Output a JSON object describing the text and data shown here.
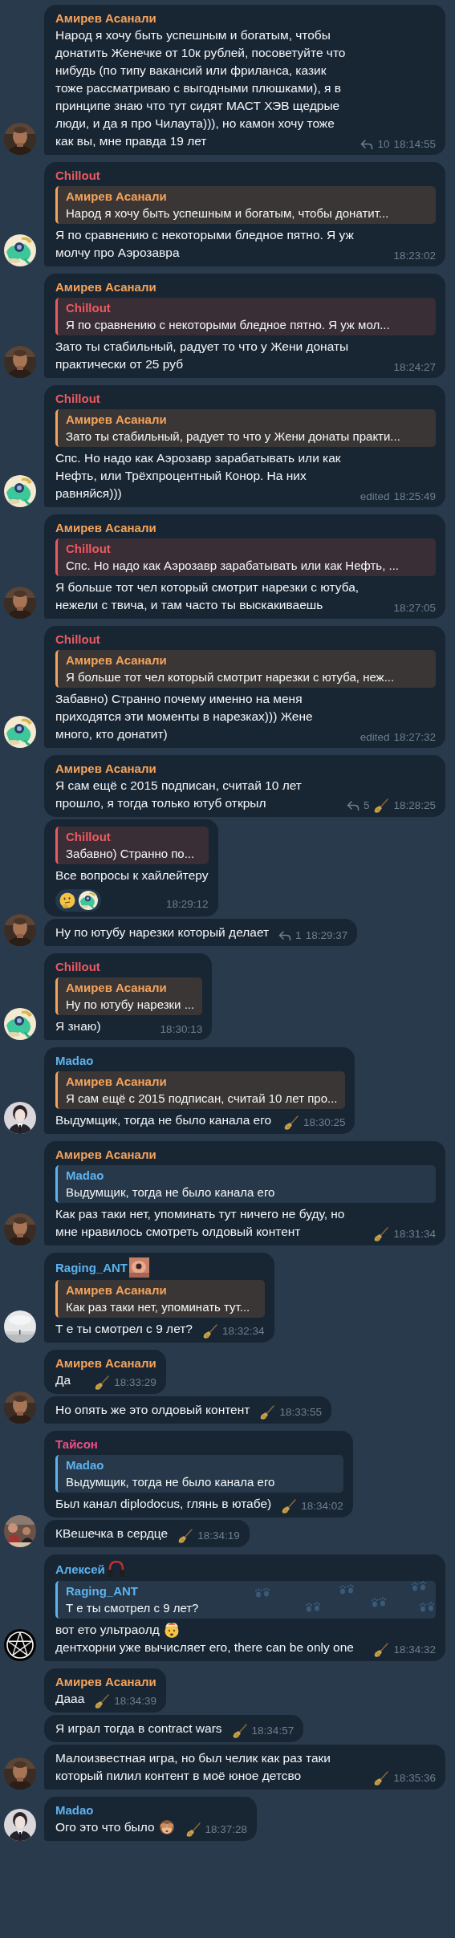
{
  "chat": {
    "groups": [
      {
        "avatar": {
          "kind": "man"
        },
        "messages": [
          {
            "sender": {
              "name": "Амирев Асанали",
              "color": "#f5a35b"
            },
            "text": "Народ я хочу быть успешным и богатым, чтобы донатить Женечке от 10к рублей, посоветуйте что нибудь (по типу вакансий или фриланса, казик тоже рассматриваю с выгодными плюшками), я в принципе знаю что тут сидят МАСТ ХЭВ щедрые люди, и да я про Чилаута))), но камон хочу тоже как вы, мне правда 19 лет",
            "replies": "10",
            "broom": false,
            "time": "18:14:55"
          }
        ]
      },
      {
        "avatar": {
          "kind": "sticker"
        },
        "messages": [
          {
            "sender": {
              "name": "Chillout",
              "color": "#ec5a5f"
            },
            "quote": {
              "name": "Амирев Асанали",
              "color": "#f5a35b",
              "text": "Народ я хочу быть успешным и богатым, чтобы донатит..."
            },
            "text": "Я по сравнению с некоторыми бледное пятно. Я уж молчу про Аэрозавра",
            "broom": false,
            "time": "18:23:02"
          }
        ]
      },
      {
        "avatar": {
          "kind": "man"
        },
        "messages": [
          {
            "sender": {
              "name": "Амирев Асанали",
              "color": "#f5a35b"
            },
            "quote": {
              "name": "Chillout",
              "color": "#ec5a5f",
              "text": "Я по сравнению с некоторыми бледное пятно. Я уж мол..."
            },
            "text": "Зато ты стабильный, радует то что у Жени донаты практически от 25 руб",
            "broom": false,
            "time": "18:24:27"
          }
        ]
      },
      {
        "avatar": {
          "kind": "sticker"
        },
        "messages": [
          {
            "sender": {
              "name": "Chillout",
              "color": "#ec5a5f"
            },
            "quote": {
              "name": "Амирев Асанали",
              "color": "#f5a35b",
              "text": "Зато ты стабильный, радует то что у Жени донаты практи..."
            },
            "text": "Спс. Но надо как Аэрозавр зарабатывать или как Нефть, или Трёхпроцентный Конор. На них равняйся)))",
            "broom": false,
            "edited": "edited",
            "time": "18:25:49"
          }
        ]
      },
      {
        "avatar": {
          "kind": "man"
        },
        "messages": [
          {
            "sender": {
              "name": "Амирев Асанали",
              "color": "#f5a35b"
            },
            "quote": {
              "name": "Chillout",
              "color": "#ec5a5f",
              "text": "Спс. Но надо как Аэрозавр зарабатывать или как Нефть, ..."
            },
            "text": "Я больше тот чел который смотрит нарезки с ютуба, нежели с твича, и там часто ты выскакиваешь",
            "broom": false,
            "time": "18:27:05"
          }
        ]
      },
      {
        "avatar": {
          "kind": "sticker"
        },
        "messages": [
          {
            "sender": {
              "name": "Chillout",
              "color": "#ec5a5f"
            },
            "quote": {
              "name": "Амирев Асанали",
              "color": "#f5a35b",
              "text": "Я больше тот чел который смотрит нарезки с ютуба, неж..."
            },
            "text": "Забавно) Странно почему именно на меня приходятся эти моменты в нарезках))) Жене много, кто донатит)",
            "broom": false,
            "edited": "edited",
            "time": "18:27:32"
          }
        ]
      },
      {
        "avatar": {
          "kind": "man"
        },
        "messages": [
          {
            "sender": {
              "name": "Амирев Асанали",
              "color": "#f5a35b"
            },
            "text": "Я сам ещё с 2015 подписан, считай 10 лет прошло, я тогда только ютуб открыл",
            "replies": "5",
            "broom": true,
            "time": "18:28:25"
          },
          {
            "quote": {
              "name": "Chillout",
              "color": "#ec5a5f",
              "text": "Забавно) Странно по..."
            },
            "text": "Все вопросы к хайлейтеру",
            "reactions": [
              {
                "kind": "thinking"
              },
              {
                "kind": "sticker"
              }
            ],
            "broom": false,
            "time": "18:29:12"
          },
          {
            "text": "Ну по ютубу нарезки который делает",
            "replies": "1",
            "broom": false,
            "time": "18:29:37"
          }
        ]
      },
      {
        "avatar": {
          "kind": "sticker"
        },
        "messages": [
          {
            "sender": {
              "name": "Chillout",
              "color": "#ec5a5f"
            },
            "quote": {
              "name": "Амирев Асанали",
              "color": "#f5a35b",
              "text": "Ну по ютубу нарезки ..."
            },
            "text": "Я знаю)",
            "broom": false,
            "time": "18:30:13"
          }
        ]
      },
      {
        "avatar": {
          "kind": "woman"
        },
        "messages": [
          {
            "sender": {
              "name": "Madao",
              "color": "#5db3ee"
            },
            "quote": {
              "name": "Амирев Асанали",
              "color": "#f5a35b",
              "text": "Я сам ещё с 2015 подписан, считай 10 лет про..."
            },
            "text": "Выдумщик, тогда не было канала его",
            "broom": true,
            "time": "18:30:25"
          }
        ]
      },
      {
        "avatar": {
          "kind": "man"
        },
        "messages": [
          {
            "sender": {
              "name": "Амирев Асанали",
              "color": "#f5a35b"
            },
            "quote": {
              "name": "Madao",
              "color": "#5db3ee",
              "text": "Выдумщик, тогда не было канала его"
            },
            "text": "Как раз таки нет, упоминать тут ничего не буду, но мне нравилось смотреть олдовый контент",
            "broom": true,
            "time": "18:31:34"
          }
        ]
      },
      {
        "avatar": {
          "kind": "mist"
        },
        "messages": [
          {
            "sender": {
              "name": "Raging_ANT",
              "color": "#5db3ee"
            },
            "quote": {
              "name": "Амирев Асанали",
              "color": "#f5a35b",
              "text": "Как раз таки нет, упоминать тут..."
            },
            "text": "Т е ты смотрел с 9 лет?",
            "broom": true,
            "time": "18:32:34"
          }
        ]
      },
      {
        "avatar": {
          "kind": "man"
        },
        "messages": [
          {
            "sender": {
              "name": "Амирев Асанали",
              "color": "#f5a35b"
            },
            "text": "Да",
            "broom": true,
            "time": "18:33:29"
          },
          {
            "text": "Но опять же это олдовый контент",
            "broom": true,
            "time": "18:33:55"
          }
        ]
      },
      {
        "avatar": {
          "kind": "crowd"
        },
        "messages": [
          {
            "sender": {
              "name": "Тайсон",
              "color": "#ee4f87"
            },
            "quote": {
              "name": "Madao",
              "color": "#5db3ee",
              "text": "Выдумщик, тогда не было канала его"
            },
            "text": "Был канал diplodocus, глянь в ютабе)",
            "broom": true,
            "time": "18:34:02"
          },
          {
            "text": "КВешечка в сердце",
            "broom": true,
            "time": "18:34:19"
          }
        ]
      },
      {
        "avatar": {
          "kind": "pentagram"
        },
        "messages": [
          {
            "sender": {
              "name": "Алексей",
              "color": "#5db3ee",
              "badge": {
                "kind": "headphones"
              }
            },
            "quote": {
              "name": "Raging_ANT",
              "color": "#5db3ee",
              "text": "Т е ты смотрел с 9 лет?",
              "backdrop": {
                "kind": "paws"
              }
            },
            "segments": [
              {
                "kind": "text",
                "text": "вот ето ультраолд "
              },
              {
                "kind": "mindblown"
              },
              {
                "kind": "text",
                "text": " дентхорни уже вычисляет его, there can be only one"
              }
            ],
            "broom": true,
            "time": "18:34:32"
          }
        ]
      },
      {
        "avatar": {
          "kind": "man"
        },
        "messages": [
          {
            "sender": {
              "name": "Амирев Асанали",
              "color": "#f5a35b"
            },
            "text": "Дааа",
            "broom": true,
            "time": "18:34:39"
          },
          {
            "text": "Я играл тогда в contract wars",
            "broom": true,
            "time": "18:34:57"
          },
          {
            "text": "Малоизвестная игра, но был челик как раз таки который пилил контент в моё юное детсво",
            "broom": true,
            "time": "18:35:36"
          }
        ]
      },
      {
        "avatar": {
          "kind": "woman"
        },
        "messages": [
          {
            "sender": {
              "name": "Madao",
              "color": "#5db3ee"
            },
            "segments": [
              {
                "kind": "text",
                "text": "Ого это что было"
              },
              {
                "kind": "monkey"
              }
            ],
            "broom": true,
            "time": "18:37:28"
          }
        ]
      }
    ]
  }
}
